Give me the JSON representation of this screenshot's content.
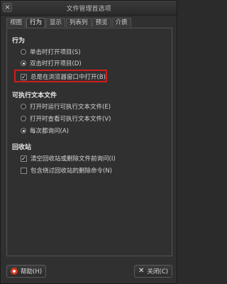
{
  "window": {
    "title": "文件管理首选项"
  },
  "tabs": [
    {
      "label": "视图"
    },
    {
      "label": "行为"
    },
    {
      "label": "显示"
    },
    {
      "label": "列表列"
    },
    {
      "label": "预览"
    },
    {
      "label": "介质"
    }
  ],
  "behavior": {
    "title": "行为",
    "single_click": "单击时打开项目(S)",
    "double_click": "双击时打开项目(D)",
    "new_window": "总是在浏览器窗口中打开(B)"
  },
  "executables": {
    "title": "可执行文本文件",
    "run": "打开时运行可执行文本文件(E)",
    "view": "打开时查看可执行文本文件(V)",
    "ask": "每次都询问(A)"
  },
  "trash": {
    "title": "回收站",
    "confirm": "清空回收站或删除文件前询问(I)",
    "include_delete": "包含绕过回收站的删除命令(N)"
  },
  "buttons": {
    "help": "帮助(H)",
    "close": "关闭(C)"
  }
}
